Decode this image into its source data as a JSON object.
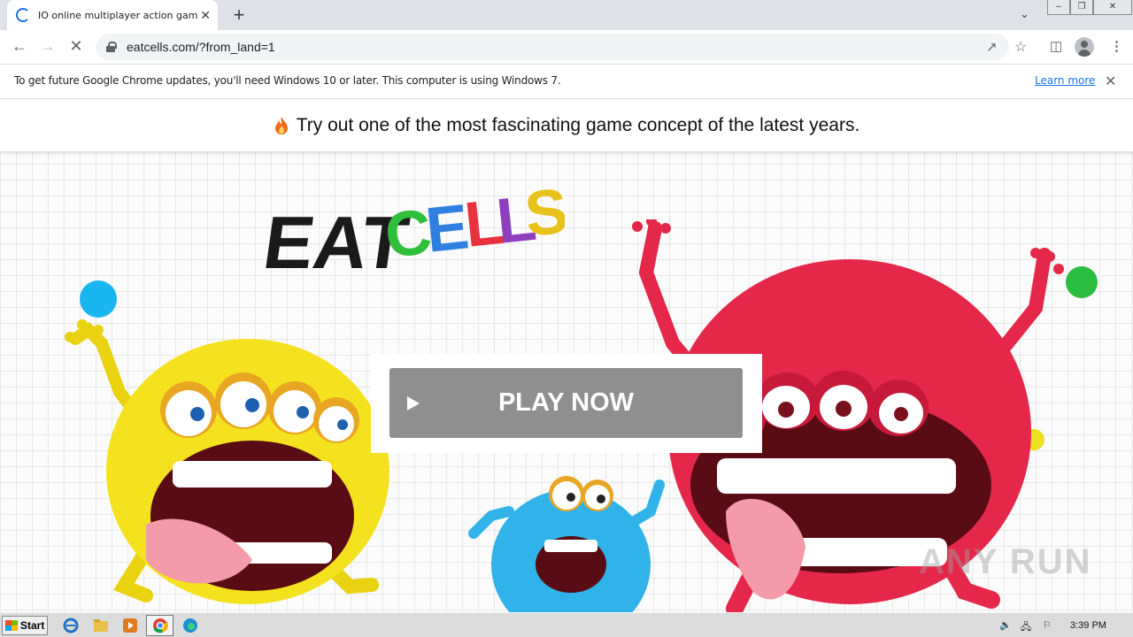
{
  "browser": {
    "tab": {
      "title": "IO online multiplayer action game. Sl"
    },
    "address_bar": {
      "url": "eatcells.com/?from_land=1"
    },
    "window_controls": {
      "minimize": "–",
      "restore": "❐",
      "close": "✕"
    }
  },
  "infobar": {
    "message": "To get future Google Chrome updates, you'll need Windows 10 or later. This computer is using Windows 7.",
    "link_label": "Learn more"
  },
  "page": {
    "banner_text": "Try out one of the most fascinating game concept of the latest years.",
    "logo": {
      "word1": "EAT",
      "word2_letters": [
        "C",
        "E",
        "L",
        "L",
        "S"
      ],
      "word2_colors": [
        "#2fbf3a",
        "#2f7fe0",
        "#e8333e",
        "#8e3fbf",
        "#e6c21a"
      ]
    },
    "play_button": {
      "label": "PLAY NOW"
    },
    "watermark": "ANY RUN"
  },
  "colors": {
    "dot_blue": "#1ab6ef",
    "dot_green": "#2bbd3f",
    "dot_yellow": "#ece020",
    "monster_yellow": "#f5e21e",
    "monster_red": "#e5284a",
    "monster_blue": "#2fb3e8"
  },
  "taskbar": {
    "start_label": "Start",
    "clock": "3:39 PM"
  }
}
